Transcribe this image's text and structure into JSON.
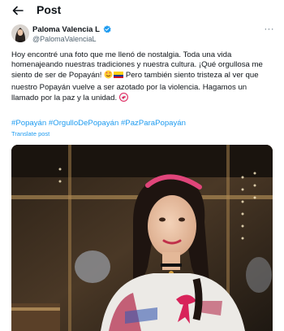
{
  "header": {
    "title": "Post",
    "back_icon": "arrow-left-icon"
  },
  "author": {
    "name": "Paloma Valencia L",
    "handle": "@PalomaValenciaL",
    "verified_icon": "verified-badge-icon",
    "more_icon": "more-horizontal-icon",
    "more_label": "···"
  },
  "tweet": {
    "line1": "Hoy encontré una foto que me llenó de nostalgia. Toda una vida",
    "line2": "homenajeando nuestras tradiciones y nuestra cultura. ¡Qué orgullosa me",
    "line3a": "siento de ser de Popayán!",
    "line3b": " Pero también siento tristeza al ver que",
    "line4": "nuestro Popayán vuelve a ser azotado por la violencia. Hagamos un",
    "line5": "llamado por la paz y la unidad."
  },
  "hashtags": [
    "#Popayán",
    "#OrgulloDePopayán",
    "#PazParaPopayán"
  ],
  "translate_label": "Translate post",
  "colors": {
    "link": "#1d9bf0",
    "text": "#0f1419",
    "muted": "#536471"
  }
}
